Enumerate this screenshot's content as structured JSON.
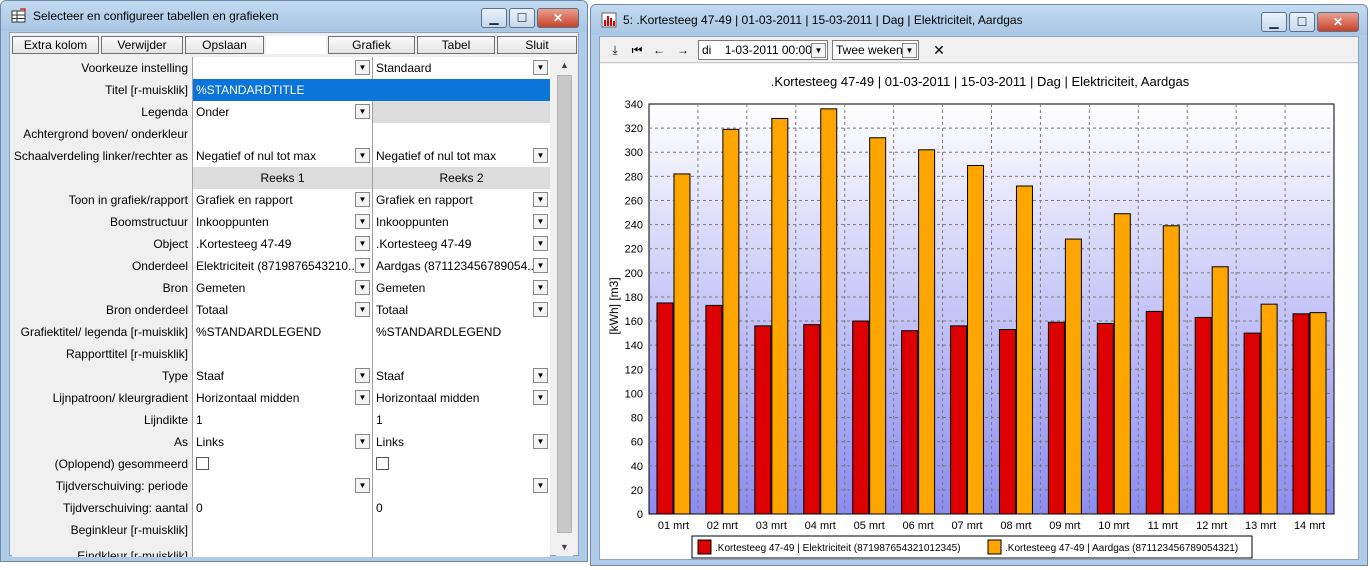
{
  "left_window": {
    "title": "Selecteer en configureer tabellen en grafieken",
    "toolbar": {
      "extra_kolom": "Extra kolom",
      "verwijder": "Verwijder",
      "opslaan": "Opslaan",
      "grafiek": "Grafiek",
      "tabel": "Tabel",
      "sluit": "Sluit"
    },
    "rows": {
      "voorkeuze": {
        "label": "Voorkeuze instelling",
        "c2": "Standaard"
      },
      "titel": {
        "label": "Titel [r-muisklik]",
        "value": "%STANDARDTITLE"
      },
      "legenda": {
        "label": "Legenda",
        "c1": "Onder"
      },
      "achtergrond": {
        "label": "Achtergrond boven/ onderkleur"
      },
      "schaal": {
        "label": "Schaalverdeling linker/rechter as",
        "c1": "Negatief of nul tot max",
        "c2": "Negatief of nul tot max"
      },
      "reeks": {
        "c1": "Reeks 1",
        "c2": "Reeks 2"
      },
      "toon": {
        "label": "Toon in grafiek/rapport",
        "c1": "Grafiek en rapport",
        "c2": "Grafiek en rapport"
      },
      "boom": {
        "label": "Boomstructuur",
        "c1": "Inkooppunten",
        "c2": "Inkooppunten"
      },
      "object": {
        "label": "Object",
        "c1": ".Kortesteeg 47-49",
        "c2": ".Kortesteeg 47-49"
      },
      "onderdeel": {
        "label": "Onderdeel",
        "c1": "Elektriciteit (8719876543210...",
        "c2": "Aardgas (871123456789054..."
      },
      "bron": {
        "label": "Bron",
        "c1": "Gemeten",
        "c2": "Gemeten"
      },
      "bron_onderdeel": {
        "label": "Bron onderdeel",
        "c1": "Totaal",
        "c2": "Totaal"
      },
      "grafiektitel": {
        "label": "Grafiektitel/ legenda [r-muisklik]",
        "c1": "%STANDARDLEGEND",
        "c2": "%STANDARDLEGEND"
      },
      "rapporttitel": {
        "label": "Rapporttitel [r-muisklik]"
      },
      "type": {
        "label": "Type",
        "c1": "Staaf",
        "c2": "Staaf"
      },
      "lijnpatroon": {
        "label": "Lijnpatroon/ kleurgradient",
        "c1": "Horizontaal midden",
        "c2": "Horizontaal midden"
      },
      "lijndikte": {
        "label": "Lijndikte",
        "c1": "1",
        "c2": "1"
      },
      "as": {
        "label": "As",
        "c1": "Links",
        "c2": "Links"
      },
      "opgelopen": {
        "label": "(Oplopend) gesommeerd"
      },
      "tijd_periode": {
        "label": "Tijdverschuiving: periode"
      },
      "tijd_aantal": {
        "label": "Tijdverschuiving: aantal",
        "c1": "0",
        "c2": "0"
      },
      "beginkleur": {
        "label": "Beginkleur [r-muisklik]"
      },
      "eindkleur": {
        "label": "Eindkleur [r-muisklik]"
      }
    }
  },
  "right_window": {
    "title": "5: .Kortesteeg 47-49 | 01-03-2011 | 15-03-2011 | Dag | Elektriciteit, Aardgas",
    "toolbar": {
      "day_value": "di",
      "date_value": "1-03-2011 00:00",
      "period_value": "Twee weken"
    }
  },
  "chart_data": {
    "type": "bar",
    "title": ".Kortesteeg 47-49 | 01-03-2011 | 15-03-2011 | Dag | Elektriciteit, Aardgas",
    "ylabel": "[kWh] [m3]",
    "xlabel": "",
    "ylim": [
      0,
      340
    ],
    "yticks": [
      0,
      20,
      40,
      60,
      80,
      100,
      120,
      140,
      160,
      180,
      200,
      220,
      240,
      260,
      280,
      300,
      320,
      340
    ],
    "grid": true,
    "legend_position": "bottom",
    "categories": [
      "01 mrt",
      "02 mrt",
      "03 mrt",
      "04 mrt",
      "05 mrt",
      "06 mrt",
      "07 mrt",
      "08 mrt",
      "09 mrt",
      "10 mrt",
      "11 mrt",
      "12 mrt",
      "13 mrt",
      "14 mrt"
    ],
    "series": [
      {
        "name": ".Kortesteeg 47-49 | Elektriciteit (871987654321012345)",
        "color": "#dd0000",
        "values": [
          175,
          173,
          156,
          157,
          160,
          152,
          156,
          153,
          159,
          158,
          168,
          163,
          150,
          166
        ]
      },
      {
        "name": ".Kortesteeg 47-49 | Aardgas (871123456789054321)",
        "color": "#ffa500",
        "values": [
          282,
          319,
          328,
          336,
          312,
          302,
          289,
          272,
          228,
          249,
          239,
          205,
          174,
          167
        ]
      }
    ]
  }
}
